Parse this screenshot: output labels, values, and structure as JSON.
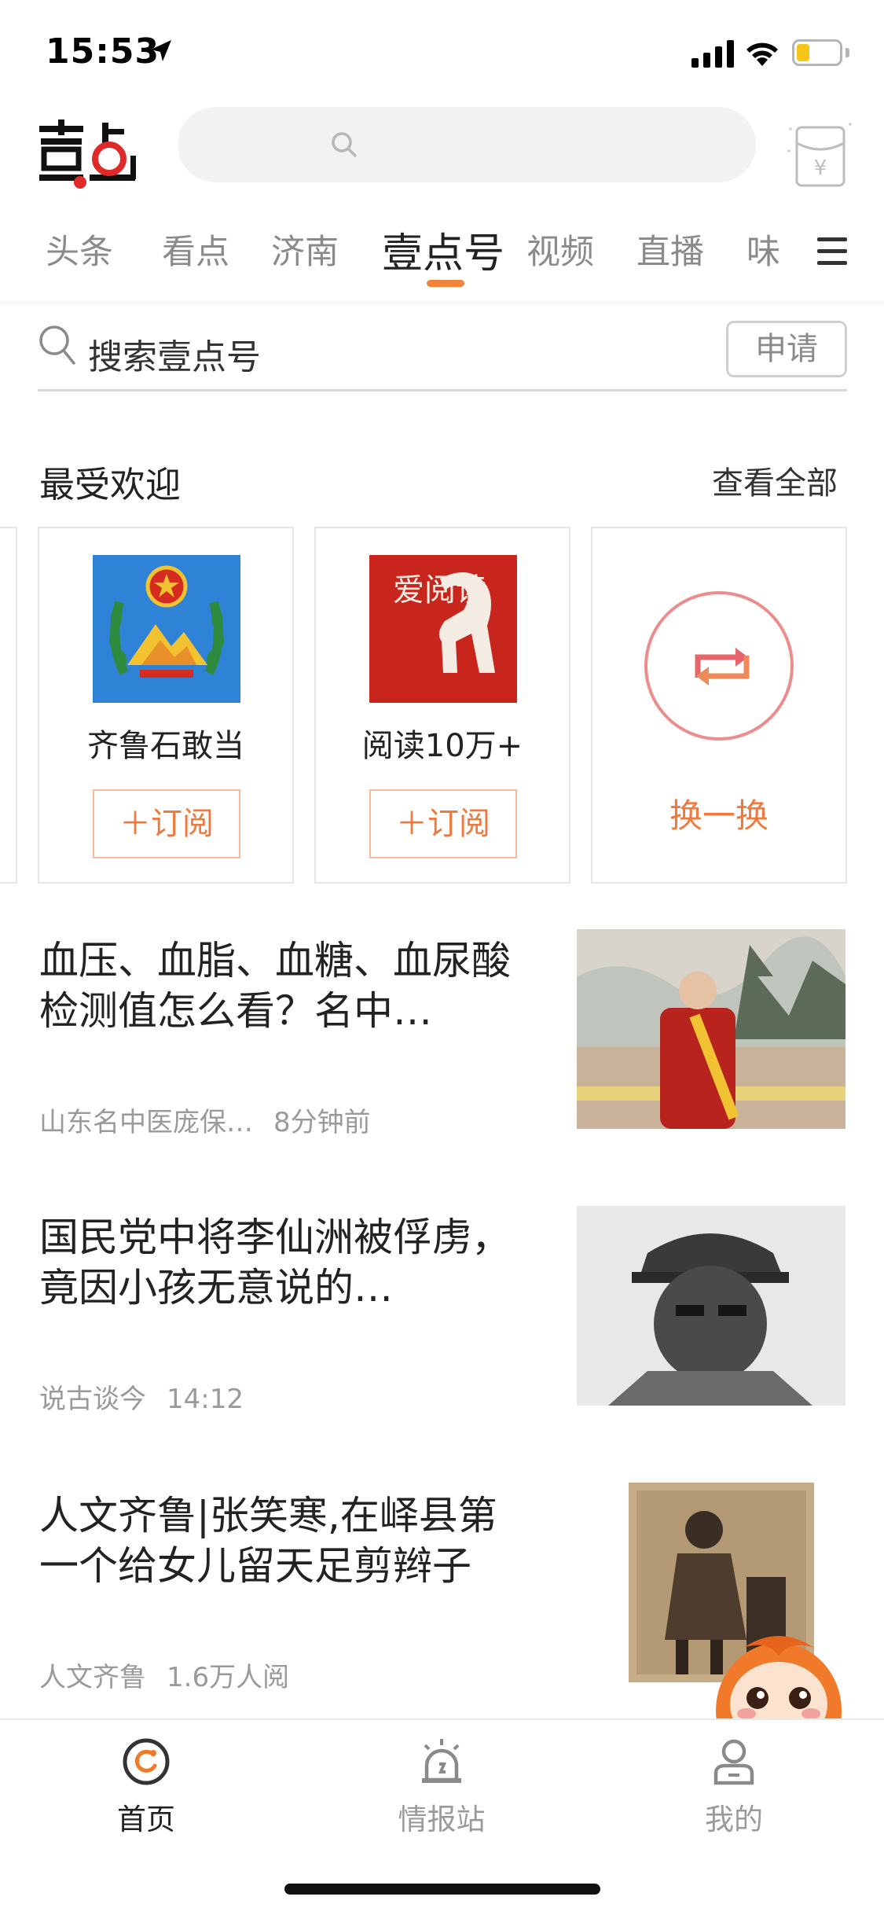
{
  "status_bar": {
    "time": "15:53",
    "battery_level": 0.3
  },
  "header": {
    "search_placeholder": ""
  },
  "tabs": [
    {
      "label": "头条"
    },
    {
      "label": "看点"
    },
    {
      "label": "济南"
    },
    {
      "label": "壹点号",
      "active": true
    },
    {
      "label": "视频"
    },
    {
      "label": "直播"
    },
    {
      "label": "味"
    }
  ],
  "account_search": {
    "placeholder": "搜索壹点号",
    "apply_label": "申请"
  },
  "popular": {
    "title": "最受欢迎",
    "view_all": "查看全部",
    "cards": [
      {
        "name": "齐鲁石敢当",
        "subscribe_label": "＋订阅"
      },
      {
        "name": "阅读10万+",
        "subscribe_label": "＋订阅",
        "seal_text": "爱阅读"
      }
    ],
    "refresh_label": "换一换"
  },
  "articles": [
    {
      "title": "血压、血脂、血糖、血尿酸检测值怎么看？名中…",
      "source": "山东名中医庞保…",
      "time": "8分钟前"
    },
    {
      "title": "国民党中将李仙洲被俘虏，竟因小孩无意说的…",
      "source": "说古谈今",
      "time": "14:12"
    },
    {
      "title": "人文齐鲁|张笑寒,在峄县第一个给女儿留天足剪辫子",
      "source": "人文齐鲁",
      "time": "1.6万人阅"
    }
  ],
  "bottom_nav": [
    {
      "label": "首页",
      "active": true
    },
    {
      "label": "情报站"
    },
    {
      "label": "我的"
    }
  ],
  "colors": {
    "accent": "#f0823a",
    "logo_red": "#e02a2a"
  }
}
